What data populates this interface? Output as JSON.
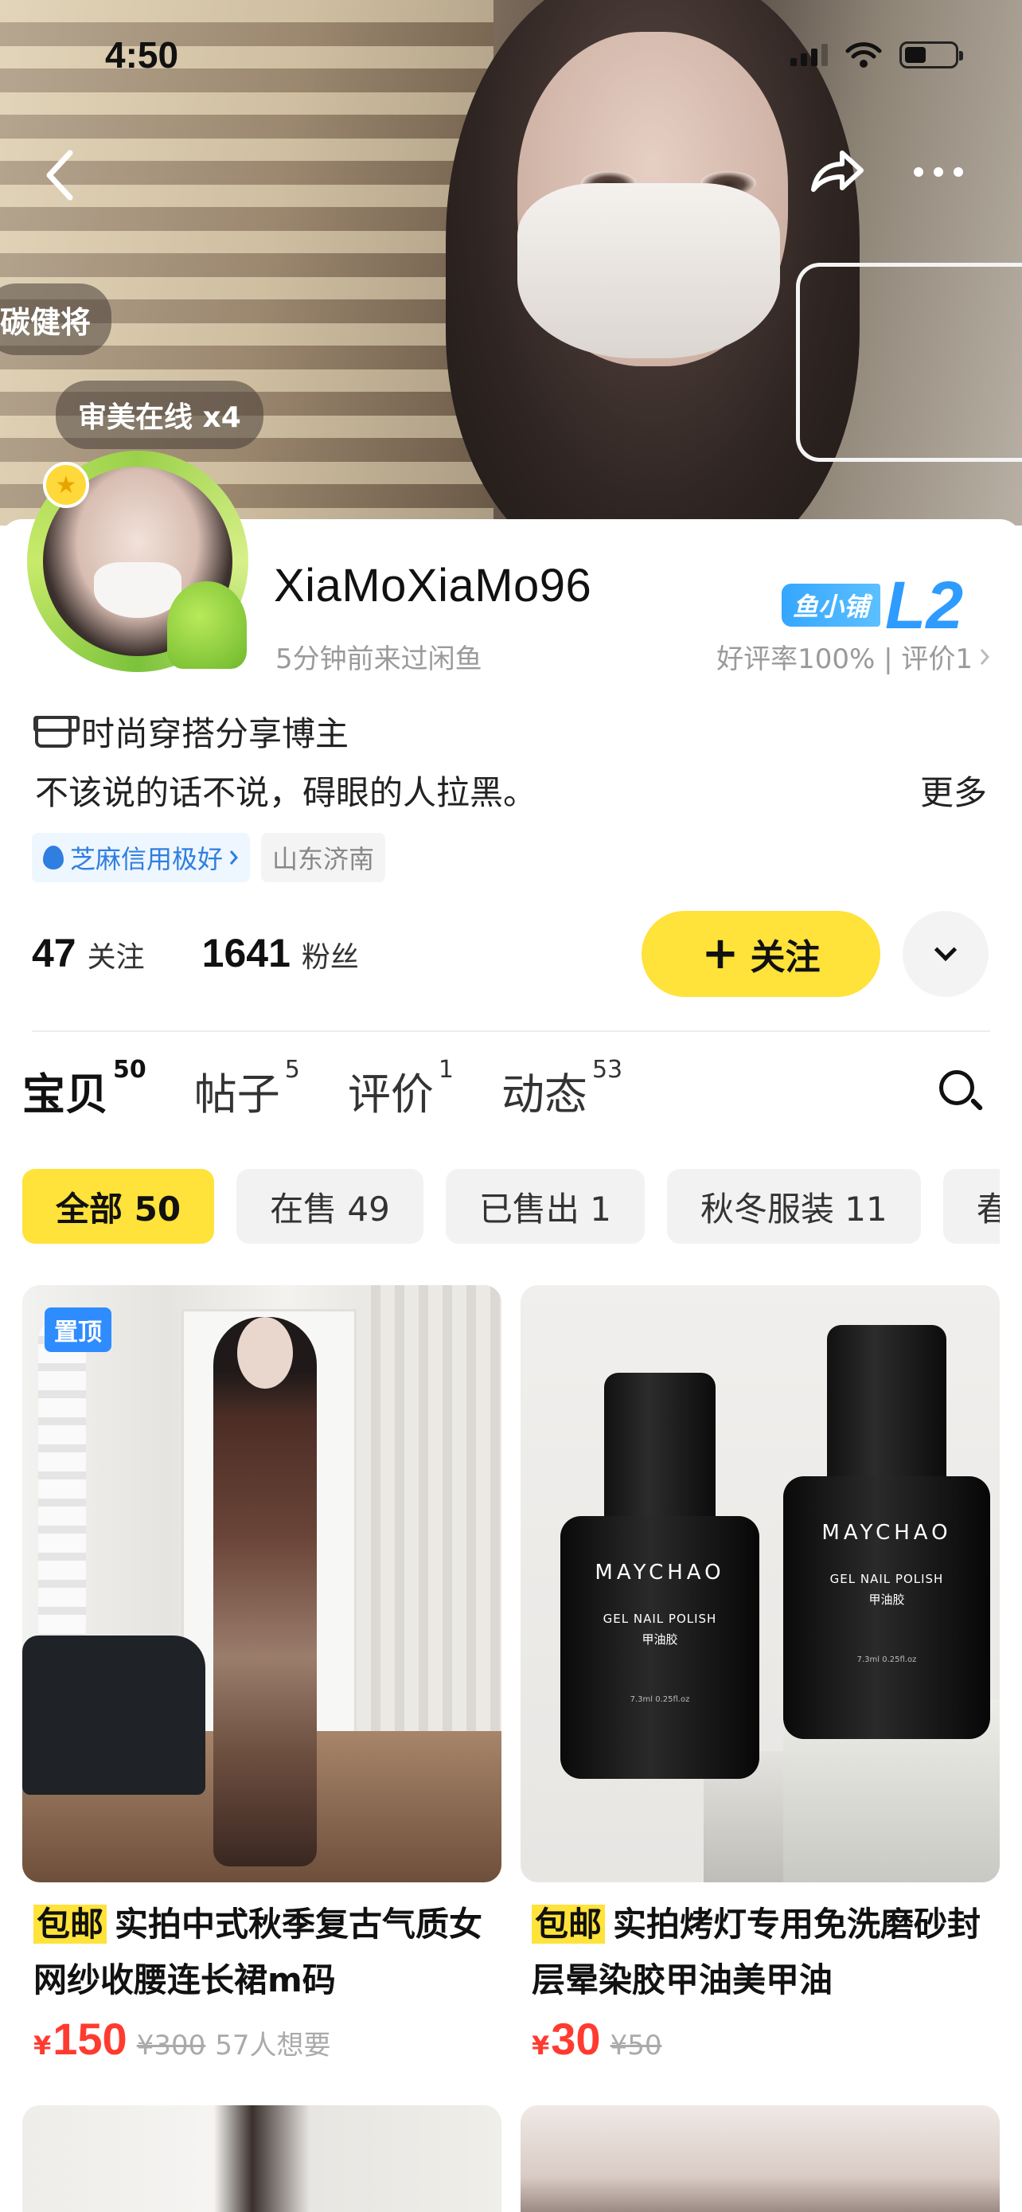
{
  "status_bar": {
    "time": "4:50"
  },
  "header": {
    "back_icon": "chevron-left-icon",
    "share_icon": "share-arrow-icon",
    "more_icon": "ellipsis-icon",
    "name_pill": "碳健将",
    "aesthetic_pill": "审美在线 x4"
  },
  "profile": {
    "username": "XiaMoXiaMo96",
    "last_seen": "5分钟前来过闲鱼",
    "shop_tag": "鱼小铺",
    "shop_level": "L2",
    "rating": "好评率100% | 评价1",
    "role": "时尚穿搭分享博主",
    "bio": "不该说的话不说，碍眼的人拉黑。",
    "bio_more": "更多",
    "credit": "芝麻信用极好",
    "location": "山东济南",
    "following_count": "47",
    "following_label": "关注",
    "followers_count": "1641",
    "followers_label": "粉丝",
    "follow_button": "关注",
    "accent_color": "#ffe23a"
  },
  "tabs": [
    {
      "label": "宝贝",
      "count": "50",
      "active": true
    },
    {
      "label": "帖子",
      "count": "5",
      "active": false
    },
    {
      "label": "评价",
      "count": "1",
      "active": false
    },
    {
      "label": "动态",
      "count": "53",
      "active": false
    }
  ],
  "filters": [
    {
      "label": "全部 50",
      "active": true
    },
    {
      "label": "在售 49",
      "active": false
    },
    {
      "label": "已售出 1",
      "active": false
    },
    {
      "label": "秋冬服装 11",
      "active": false
    },
    {
      "label": "春",
      "active": false
    }
  ],
  "products": [
    {
      "pinned_label": "置顶",
      "free_ship": "包邮",
      "title": "实拍中式秋季复古气质女网纱收腰连长裙m码",
      "currency": "¥",
      "price": "150",
      "original_price": "¥300",
      "wants": "57人想要"
    },
    {
      "free_ship": "包邮",
      "title": "实拍烤灯专用免洗磨砂封层晕染胶甲油美甲油",
      "currency": "¥",
      "price": "30",
      "original_price": "¥50",
      "brand": "MAYCHAO",
      "product_sub": "GEL NAIL POLISH",
      "product_cn": "甲油胶",
      "volume": "7.3ml 0.25fl.oz"
    }
  ]
}
